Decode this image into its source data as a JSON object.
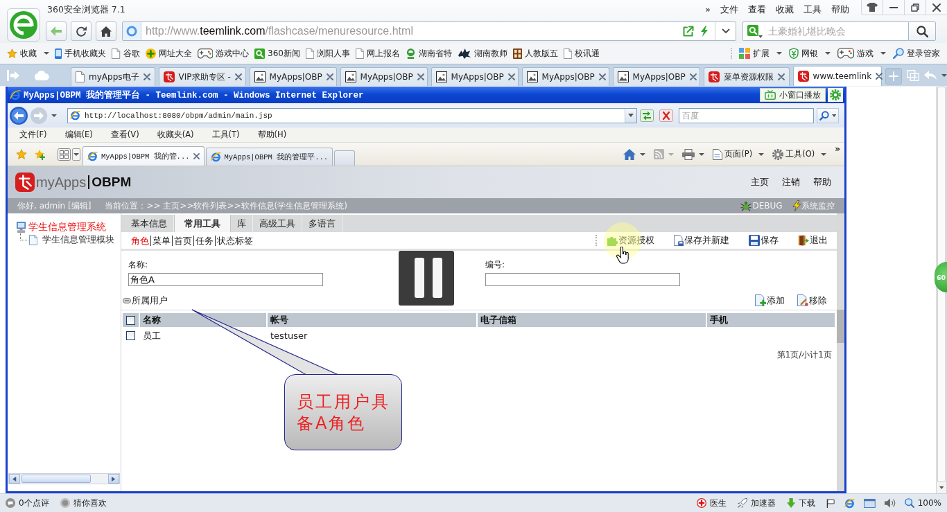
{
  "browser": {
    "title": "360安全浏览器 7.1",
    "menu_more": "»",
    "menu": [
      "文件",
      "查看",
      "收藏",
      "工具",
      "帮助"
    ],
    "address": {
      "scheme": "http://www.",
      "domain": "teemlink.com",
      "path": "/flashcase/menuresource.html"
    },
    "search": {
      "placeholder": "土豪婚礼堪比晚会"
    },
    "bookmarks": [
      {
        "label": "收藏",
        "kind": "star",
        "menu": true
      },
      {
        "label": "手机收藏夹",
        "kind": "phone",
        "menu": false
      },
      {
        "label": "谷歌",
        "kind": "page",
        "menu": false
      },
      {
        "label": "网址大全",
        "kind": "plusdisc",
        "menu": false
      },
      {
        "label": "游戏中心",
        "kind": "gamepad",
        "menu": false
      },
      {
        "label": "360新闻",
        "kind": "news",
        "menu": false
      },
      {
        "label": "浏阳人事",
        "kind": "page",
        "menu": false
      },
      {
        "label": "网上报名",
        "kind": "page",
        "menu": false
      },
      {
        "label": "湖南省特",
        "kind": "leaf",
        "menu": false
      },
      {
        "label": "湖南教师",
        "kind": "splat",
        "menu": false
      },
      {
        "label": "人教版五",
        "kind": "book",
        "menu": false
      },
      {
        "label": "校讯通",
        "kind": "page",
        "menu": false
      }
    ],
    "extras": [
      {
        "label": "扩展",
        "kind": "grid4",
        "menu": true
      },
      {
        "label": "网银",
        "kind": "shield",
        "menu": true
      },
      {
        "label": "游戏",
        "kind": "gamepad",
        "menu": true
      },
      {
        "label": "登录管家",
        "kind": "key",
        "menu": false
      }
    ],
    "tabs": [
      {
        "label": "myApps电子",
        "kind": "page",
        "selected": false
      },
      {
        "label": "VIP求助专区 -",
        "kind": "mascot",
        "selected": false
      },
      {
        "label": "MyApps|OBP",
        "kind": "image",
        "selected": false
      },
      {
        "label": "MyApps|OBP",
        "kind": "image",
        "selected": false
      },
      {
        "label": "MyApps|OBP",
        "kind": "image",
        "selected": false
      },
      {
        "label": "MyApps|OBP",
        "kind": "image",
        "selected": false
      },
      {
        "label": "MyApps|OBP",
        "kind": "image",
        "selected": false
      },
      {
        "label": "菜单资源权限",
        "kind": "mascot",
        "selected": false
      },
      {
        "label": "www.teemlink",
        "kind": "mascot",
        "selected": true
      }
    ]
  },
  "ie": {
    "title": "MyApps|OBPM 我的管理平台 - Teemlink.com - Windows Internet Explorer",
    "address": "http://localhost:8080/obpm/admin/main.jsp",
    "search": {
      "placeholder": "百度"
    },
    "menu": [
      "文件(F)",
      "编辑(E)",
      "查看(V)",
      "收藏夹(A)",
      "工具(T)",
      "帮助(H)"
    ],
    "tabs": [
      {
        "label": "MyApps|OBPM 我的管...",
        "selected": true
      },
      {
        "label": "MyApps|OBPM 我的管理平...",
        "selected": false
      }
    ],
    "commands": [
      {
        "label": "页面(P)",
        "kind": "pagedoc"
      },
      {
        "label": "工具(O)",
        "kind": "gear"
      }
    ],
    "commands_more": "»"
  },
  "video_overlay": {
    "label": "小窗口播放"
  },
  "app": {
    "logo": {
      "name": "myApps",
      "product": "OBPM"
    },
    "nav": [
      "主页",
      "注销",
      "帮助"
    ],
    "greeting": "你好, admin [编辑]",
    "breadcrumb": "当前位置：>> 主页>>软件列表>>软件信息(学生信息管理系统)",
    "tools": [
      {
        "label": "DEBUG",
        "kind": "bug"
      },
      {
        "label": "系统监控",
        "kind": "lightning"
      }
    ],
    "tree": [
      {
        "label": "学生信息管理系统",
        "selected": true,
        "children": [
          {
            "label": "学生信息管理模块",
            "selected": false
          }
        ]
      }
    ],
    "tabs": [
      {
        "label": "基本信息",
        "selected": false
      },
      {
        "label": "常用工具",
        "selected": true
      },
      {
        "label": "库",
        "selected": false
      },
      {
        "label": "高级工具",
        "selected": false
      },
      {
        "label": "多语言",
        "selected": false
      }
    ],
    "subtabs": [
      {
        "label": "角色",
        "selected": true
      },
      {
        "label": "菜单",
        "selected": false
      },
      {
        "label": "首页",
        "selected": false
      },
      {
        "label": "任务",
        "selected": false
      },
      {
        "label": "状态标签",
        "selected": false
      }
    ],
    "actions": [
      {
        "label": "资源授权",
        "kind": "puzzle"
      },
      {
        "label": "保存并新建",
        "kind": "savenew"
      },
      {
        "label": "保存",
        "kind": "save"
      },
      {
        "label": "退出",
        "kind": "exit"
      }
    ],
    "fields": [
      {
        "label": "名称:",
        "value": "角色A"
      },
      {
        "label": "编号:"
      }
    ],
    "section": {
      "title": "所属用户",
      "buttons": [
        {
          "label": "添加",
          "kind": "add"
        },
        {
          "label": "移除",
          "kind": "remove"
        }
      ]
    },
    "table": {
      "all_checked": false,
      "columns": [
        "名称",
        "帐号",
        "电子信箱",
        "手机"
      ],
      "rows": [
        {
          "checked": false,
          "cells": [
            "员工",
            "testuser"
          ]
        }
      ]
    },
    "pager": "第1页/小计1页"
  },
  "callout": {
    "text": "员工用户具备A角色"
  },
  "side_badge": {
    "label": "60"
  },
  "status": {
    "left": [
      {
        "label": "0个点评",
        "kind": "comment"
      },
      {
        "label": "猜你喜欢",
        "kind": "dot"
      }
    ],
    "right": [
      {
        "label": "医生",
        "kind": "doctor"
      },
      {
        "label": "加速器",
        "kind": "rocket"
      },
      {
        "label": "下载",
        "kind": "download"
      }
    ],
    "zoom": "100%"
  }
}
